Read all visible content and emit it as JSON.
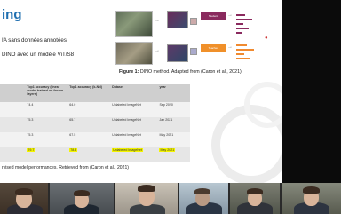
{
  "slide": {
    "title": "ing",
    "bullets": [
      "IA sans données annotées",
      "DINO avec un modèle ViT/S8"
    ],
    "figure": {
      "box_student": "Student",
      "box_teacher": "Teacher",
      "caption_label": "Figure 1:",
      "caption_text": " DINO method. Adapted from (Caron et al., 2021)"
    },
    "table": {
      "headers": [
        "",
        "Top1 accuracy (linear model trained on frozen layers)",
        "Top1 accuracy (k-NN)",
        "Dataset",
        "year"
      ],
      "rows": [
        [
          "",
          "74.4",
          "64.0",
          "Unlabeled ImageNet",
          "Sep 2020"
        ],
        [
          "",
          "75.3",
          "65.7",
          "Unlabeled ImageNet",
          "Jan 2021"
        ],
        [
          "",
          "75.3",
          "67.5",
          "Unlabeled ImageNet",
          "May 2021"
        ],
        [
          "",
          "79.7",
          "78.3",
          "Unlabeled ImageNet",
          "May 2021"
        ]
      ],
      "highlight_row_index": 3
    },
    "table_caption": "rvised model performances. Retrieved from (Caron et al., 2021)"
  },
  "colors": {
    "title_blue": "#1f6fb0",
    "highlight_yellow": "#f4f400",
    "student_purple": "#8a2a5e",
    "teacher_orange": "#f0902a"
  },
  "video_participants": [
    {
      "name": "participant-1"
    },
    {
      "name": "participant-2"
    },
    {
      "name": "participant-3"
    },
    {
      "name": "participant-4"
    },
    {
      "name": "participant-5"
    },
    {
      "name": "participant-6"
    }
  ]
}
